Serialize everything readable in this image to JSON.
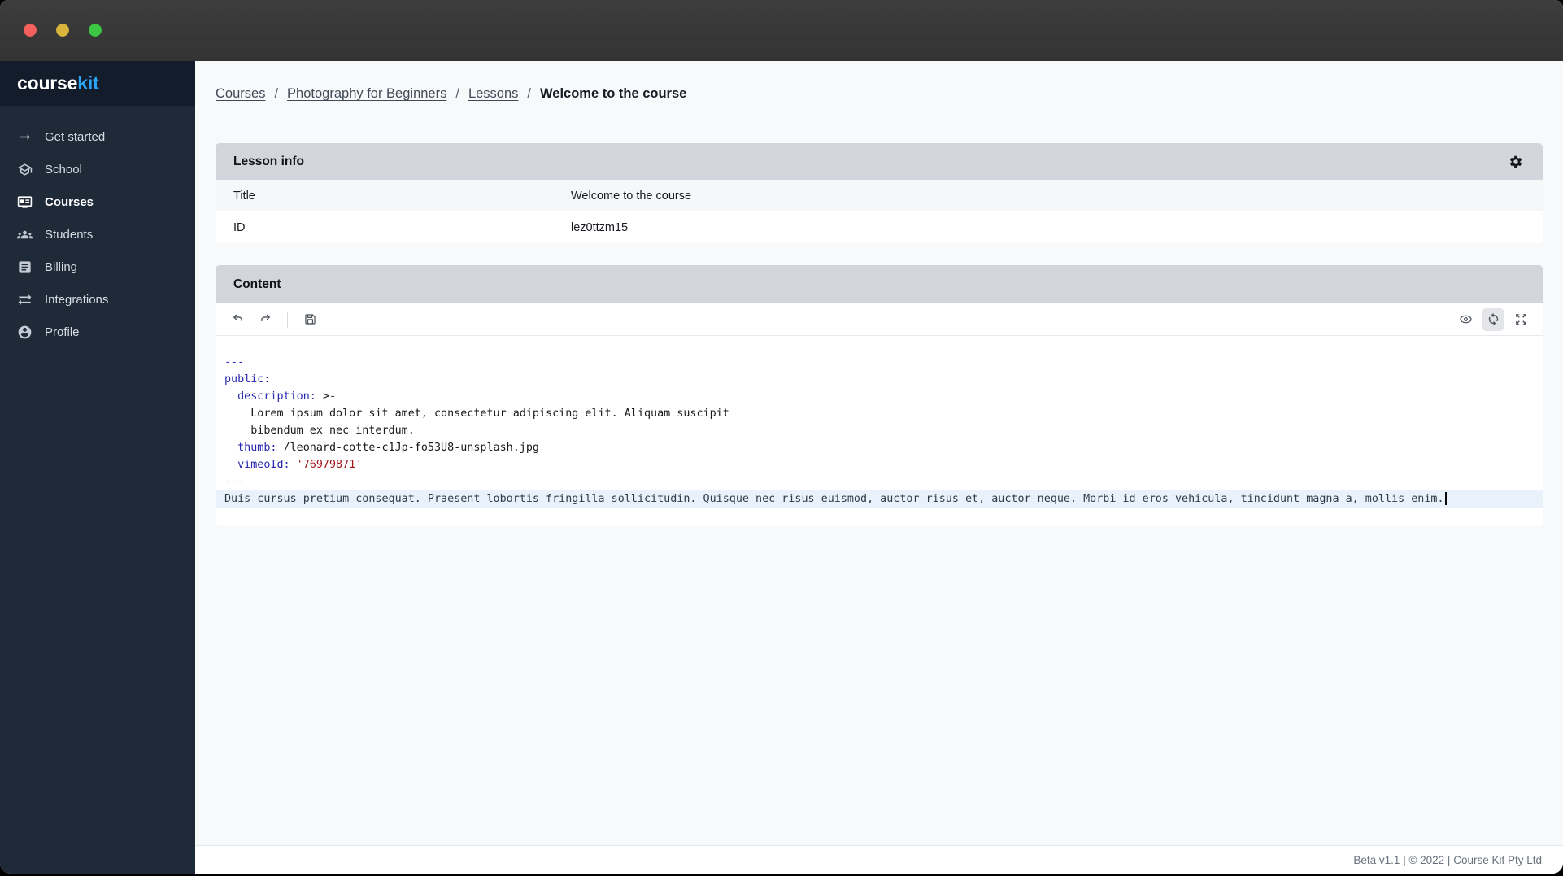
{
  "window": {
    "controls": [
      {
        "icon": "close-button",
        "color": "#f4615c"
      },
      {
        "icon": "minimize-button",
        "color": "#d9b53e"
      },
      {
        "icon": "zoom-button",
        "color": "#3dc544"
      }
    ]
  },
  "brand": {
    "text_primary": "course",
    "text_accent": "kit",
    "accent_color": "#2aa4f5"
  },
  "sidebar": {
    "items": [
      {
        "label": "Get started",
        "icon": "arrow-right-icon",
        "active": false
      },
      {
        "label": "School",
        "icon": "school-icon",
        "active": false
      },
      {
        "label": "Courses",
        "icon": "courses-card-icon",
        "active": true
      },
      {
        "label": "Students",
        "icon": "students-group-icon",
        "active": false
      },
      {
        "label": "Billing",
        "icon": "billing-list-icon",
        "active": false
      },
      {
        "label": "Integrations",
        "icon": "integrations-arrows-icon",
        "active": false
      },
      {
        "label": "Profile",
        "icon": "profile-icon",
        "active": false
      }
    ]
  },
  "breadcrumb": {
    "separator": "/",
    "items": [
      {
        "label": "Courses"
      },
      {
        "label": "Photography for Beginners"
      },
      {
        "label": "Lessons"
      }
    ],
    "current": "Welcome to the course"
  },
  "lesson_info": {
    "title": "Lesson info",
    "header_icon": "gear-icon",
    "rows": [
      {
        "label": "Title",
        "value": "Welcome to the course"
      },
      {
        "label": "ID",
        "value": "lez0ttzm15"
      }
    ]
  },
  "content_panel": {
    "title": "Content",
    "toolbar": {
      "left_icons": [
        "undo-icon",
        "redo-icon",
        "save-icon"
      ],
      "right_icons": [
        "preview-eye-icon",
        "sync-icon",
        "fullscreen-icon"
      ],
      "active_icon": "sync-icon"
    },
    "editor": {
      "code": {
        "delim_top": "---",
        "key_public": "public:",
        "key_description": "  description:",
        "block_scalar": " >-",
        "desc_text_1": "    Lorem ipsum dolor sit amet, consectetur adipiscing elit. Aliquam suscipit",
        "desc_text_2": "    bibendum ex nec interdum.",
        "key_thumb": "  thumb:",
        "thumb_value": " /leonard-cotte-c1Jp-fo53U8-unsplash.jpg",
        "key_vimeo": "  vimeoId:",
        "vimeo_value": " '76979871'",
        "delim_bottom": "---",
        "body_text": "Duis cursus pretium consequat. Praesent lobortis fringilla sollicitudin. Quisque nec risus euismod, auctor risus et, auctor neque. Morbi id eros vehicula, tincidunt magna a, mollis enim."
      }
    }
  },
  "footer": {
    "text": "Beta v1.1 | © 2022 | Course Kit Pty Ltd"
  },
  "colors": {
    "titlebar": "#383838",
    "sidebar_bg": "#1f2a39",
    "sidebar_logo_band_bg": "#131c2b",
    "panel_header_gray": "#d2d5dc",
    "page_bg": "#f8f9fa",
    "active_line_highlight": "#e9f1fb",
    "code_key_blue": "#2828b0",
    "code_string_red": "#a31515"
  }
}
